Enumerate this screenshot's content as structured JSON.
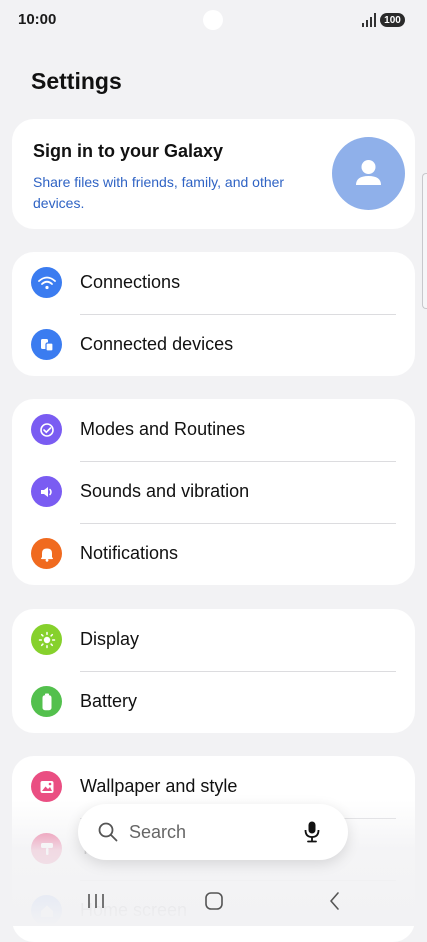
{
  "status_bar": {
    "time": "10:00",
    "battery": "100"
  },
  "page_title": "Settings",
  "account": {
    "title": "Sign in to your Galaxy",
    "subtitle": "Share files with friends, family, and other devices."
  },
  "groups": [
    {
      "items": [
        {
          "label": "Connections",
          "icon": "wifi-icon",
          "color": "#3b7cf0"
        },
        {
          "label": "Connected devices",
          "icon": "devices-icon",
          "color": "#3b7cf0"
        }
      ]
    },
    {
      "items": [
        {
          "label": "Modes and Routines",
          "icon": "routines-icon",
          "color": "#7a5cf2"
        },
        {
          "label": "Sounds and vibration",
          "icon": "volume-icon",
          "color": "#7a5cf2"
        },
        {
          "label": "Notifications",
          "icon": "bell-icon",
          "color": "#f06a1f"
        }
      ]
    },
    {
      "items": [
        {
          "label": "Display",
          "icon": "sun-icon",
          "color": "#86d12c"
        },
        {
          "label": "Battery",
          "icon": "battery-icon",
          "color": "#53c04d"
        }
      ]
    },
    {
      "items": [
        {
          "label": "Wallpaper and style",
          "icon": "wallpaper-icon",
          "color": "#ea4e82"
        },
        {
          "label": "Themes",
          "icon": "themes-icon",
          "color": "#ea4e82"
        },
        {
          "label": "Home screen",
          "icon": "home-icon",
          "color": "#3b7cf0"
        }
      ]
    }
  ],
  "search": {
    "label": "Search",
    "icon": "search-icon",
    "mic_icon": "microphone-icon"
  },
  "nav": {
    "recents_icon": "recents-icon",
    "home_icon": "home-button-icon",
    "back_icon": "back-icon"
  }
}
